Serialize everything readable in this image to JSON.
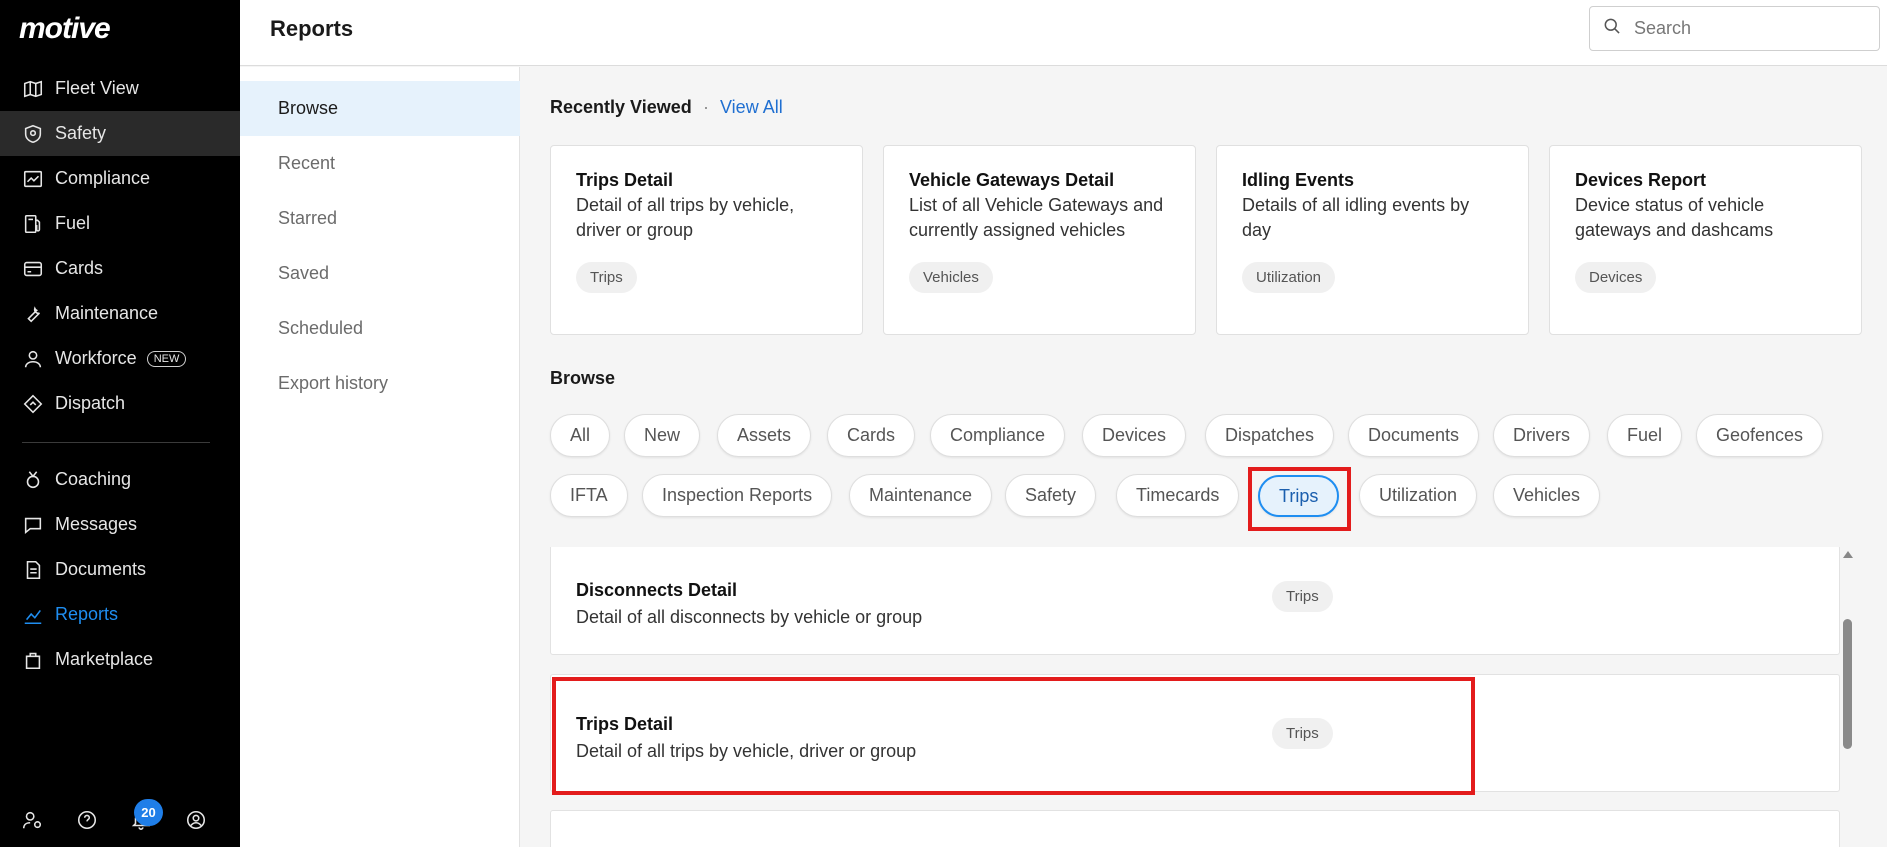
{
  "brand": {
    "logo": "motive"
  },
  "sidebar": {
    "items": [
      {
        "label": "Fleet View",
        "icon": "map-icon"
      },
      {
        "label": "Safety",
        "icon": "shield-icon"
      },
      {
        "label": "Compliance",
        "icon": "compliance-icon"
      },
      {
        "label": "Fuel",
        "icon": "fuel-icon"
      },
      {
        "label": "Cards",
        "icon": "card-icon"
      },
      {
        "label": "Maintenance",
        "icon": "wrench-icon"
      },
      {
        "label": "Workforce",
        "icon": "person-icon",
        "badge": "NEW"
      },
      {
        "label": "Dispatch",
        "icon": "dispatch-icon"
      },
      {
        "label": "Coaching",
        "icon": "coaching-icon"
      },
      {
        "label": "Messages",
        "icon": "chat-icon"
      },
      {
        "label": "Documents",
        "icon": "document-icon"
      },
      {
        "label": "Reports",
        "icon": "chart-icon"
      },
      {
        "label": "Marketplace",
        "icon": "bag-icon"
      }
    ],
    "notification_count": "20"
  },
  "header": {
    "title": "Reports",
    "search_placeholder": "Search"
  },
  "subnav": {
    "items": [
      "Browse",
      "Recent",
      "Starred",
      "Saved",
      "Scheduled",
      "Export history"
    ]
  },
  "recently_viewed": {
    "title": "Recently Viewed",
    "separator": "·",
    "view_all": "View All",
    "cards": [
      {
        "title": "Trips Detail",
        "desc_line1": "Detail of all trips by vehicle,",
        "desc_line2": "driver or group",
        "tag": "Trips"
      },
      {
        "title": "Vehicle Gateways Detail",
        "desc_line1": "List of all Vehicle Gateways and",
        "desc_line2": "currently assigned vehicles",
        "tag": "Vehicles"
      },
      {
        "title": "Idling Events",
        "desc_line1": "Details of all idling events by",
        "desc_line2": "day",
        "tag": "Utilization"
      },
      {
        "title": "Devices Report",
        "desc_line1": "Device status of vehicle",
        "desc_line2": "gateways and dashcams",
        "tag": "Devices"
      }
    ]
  },
  "browse": {
    "title": "Browse",
    "categories_row1": [
      "All",
      "New",
      "Assets",
      "Cards",
      "Compliance",
      "Devices",
      "Dispatches",
      "Documents",
      "Drivers",
      "Fuel",
      "Geofences"
    ],
    "categories_row2": [
      "IFTA",
      "Inspection Reports",
      "Maintenance",
      "Safety",
      "Timecards",
      "Trips",
      "Utilization",
      "Vehicles"
    ],
    "selected": "Trips"
  },
  "reports": [
    {
      "title": "Disconnects Detail",
      "desc": "Detail of all disconnects by vehicle or group",
      "tag": "Trips"
    },
    {
      "title": "Trips Detail",
      "desc": "Detail of all trips by vehicle, driver or group",
      "tag": "Trips"
    }
  ],
  "colors": {
    "accent": "#1f8ef1",
    "link": "#1f6fd1",
    "highlight": "#e31c1c",
    "sidebar_bg": "#000000"
  }
}
